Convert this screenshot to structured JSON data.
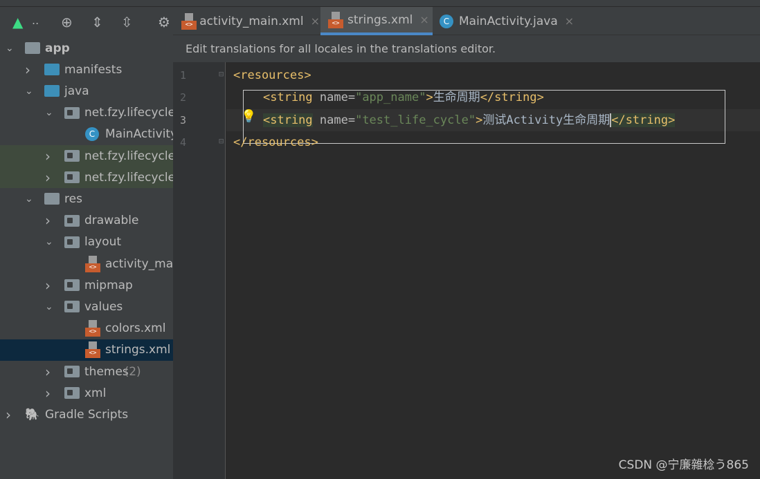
{
  "toolbar": {
    "android_label": "..",
    "icons": [
      "android-icon",
      "locate-icon",
      "expand-all-icon",
      "collapse-all-icon",
      "gear-icon"
    ]
  },
  "tabs": [
    {
      "label": "activity_main.xml",
      "icon": "xml-icon",
      "close": "×"
    },
    {
      "label": "strings.xml",
      "icon": "xml-icon",
      "close": "×",
      "active": true
    },
    {
      "label": "MainActivity.java",
      "icon": "class-icon",
      "icon_text": "C",
      "close": "×"
    }
  ],
  "info_bar": "Edit translations for all locales in the translations editor.",
  "tree": [
    {
      "label": "app",
      "level": 0,
      "expanded": true
    },
    {
      "label": "manifests",
      "level": 1,
      "expanded": false
    },
    {
      "label": "java",
      "level": 1,
      "expanded": true
    },
    {
      "label": "net.fzy.lifecycle",
      "level": 2,
      "expanded": true
    },
    {
      "label": "MainActivity",
      "level": 3,
      "icon": "C"
    },
    {
      "label": "net.fzy.lifecycle",
      "level": 2,
      "expanded": false
    },
    {
      "label": "net.fzy.lifecycle",
      "level": 2,
      "expanded": false
    },
    {
      "label": "res",
      "level": 1,
      "expanded": true
    },
    {
      "label": "drawable",
      "level": 2,
      "expanded": false
    },
    {
      "label": "layout",
      "level": 2,
      "expanded": true
    },
    {
      "label": "activity_main",
      "level": 3
    },
    {
      "label": "mipmap",
      "level": 2,
      "expanded": false
    },
    {
      "label": "values",
      "level": 2,
      "expanded": true
    },
    {
      "label": "colors.xml",
      "level": 3
    },
    {
      "label": "strings.xml",
      "level": 3,
      "selected": true
    },
    {
      "label": "themes",
      "count": "(2)",
      "level": 2,
      "expanded": false
    },
    {
      "label": "xml",
      "level": 2,
      "expanded": false
    },
    {
      "label": "Gradle Scripts",
      "level": 0,
      "expanded": false
    }
  ],
  "code": {
    "line_numbers": [
      "1",
      "2",
      "3",
      "4"
    ],
    "l1": "<resources>",
    "l2": {
      "open": "<string",
      "attr": " name=",
      "val": "\"app_name\"",
      "gt": ">",
      "text": "生命周期",
      "close": "</string>"
    },
    "l3": {
      "open": "<string",
      "attr": " name=",
      "val": "\"test_life_cycle\"",
      "gt": ">",
      "text": "测试Activity生命周期",
      "close": "</string>"
    },
    "l4": "</resources>"
  },
  "watermark": "CSDN @宁廉雜棯う865"
}
